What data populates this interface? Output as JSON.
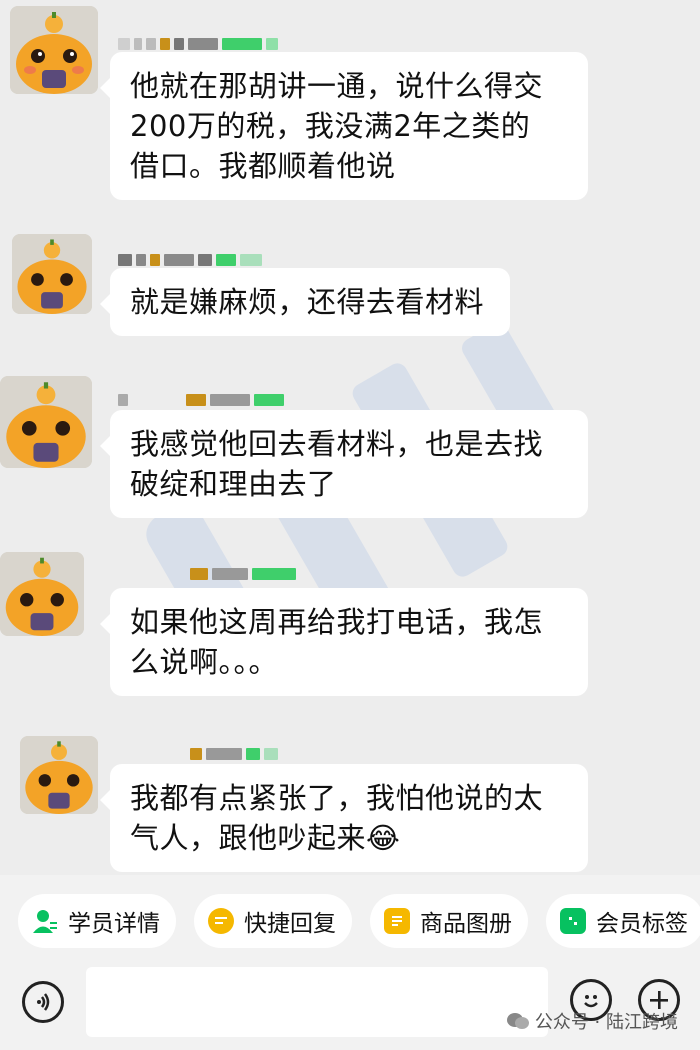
{
  "colors": {
    "background": "#ededed",
    "bubble": "#ffffff",
    "accent_green": "#07c160",
    "accent_yellow": "#f5a623",
    "name_blur_dark": "#7a7a7a",
    "name_blur_green": "#3fcf6b",
    "name_blur_gold": "#c8901a"
  },
  "messages": [
    {
      "text_lines": [
        "他就在那胡讲一通，说什么得交",
        "200万的税，我没满2年之类的",
        "借口。我都顺着他说"
      ]
    },
    {
      "text_lines": [
        "就是嫌麻烦，还得去看材料"
      ]
    },
    {
      "text_lines": [
        "我感觉他回去看材料，也是去找",
        "破绽和理由去了"
      ]
    },
    {
      "text_lines": [
        "如果他这周再给我打电话，我怎",
        "么说啊。。。"
      ]
    },
    {
      "text_lines": [
        "我都有点紧张了，我怕他说的太",
        "气人，跟他吵起来😂"
      ]
    }
  ],
  "quick_actions": [
    {
      "label": "学员详情",
      "icon": "user-profile-icon"
    },
    {
      "label": "快捷回复",
      "icon": "chat-bubble-icon"
    },
    {
      "label": "商品图册",
      "icon": "document-icon"
    },
    {
      "label": "会员标签",
      "icon": "tag-icon"
    }
  ],
  "input_bar": {
    "voice_icon": "voice-icon",
    "emoji_icon": "emoji-icon",
    "plus_icon": "plus-icon"
  },
  "watermark": {
    "text": "公众号 · 陆江跨境"
  }
}
